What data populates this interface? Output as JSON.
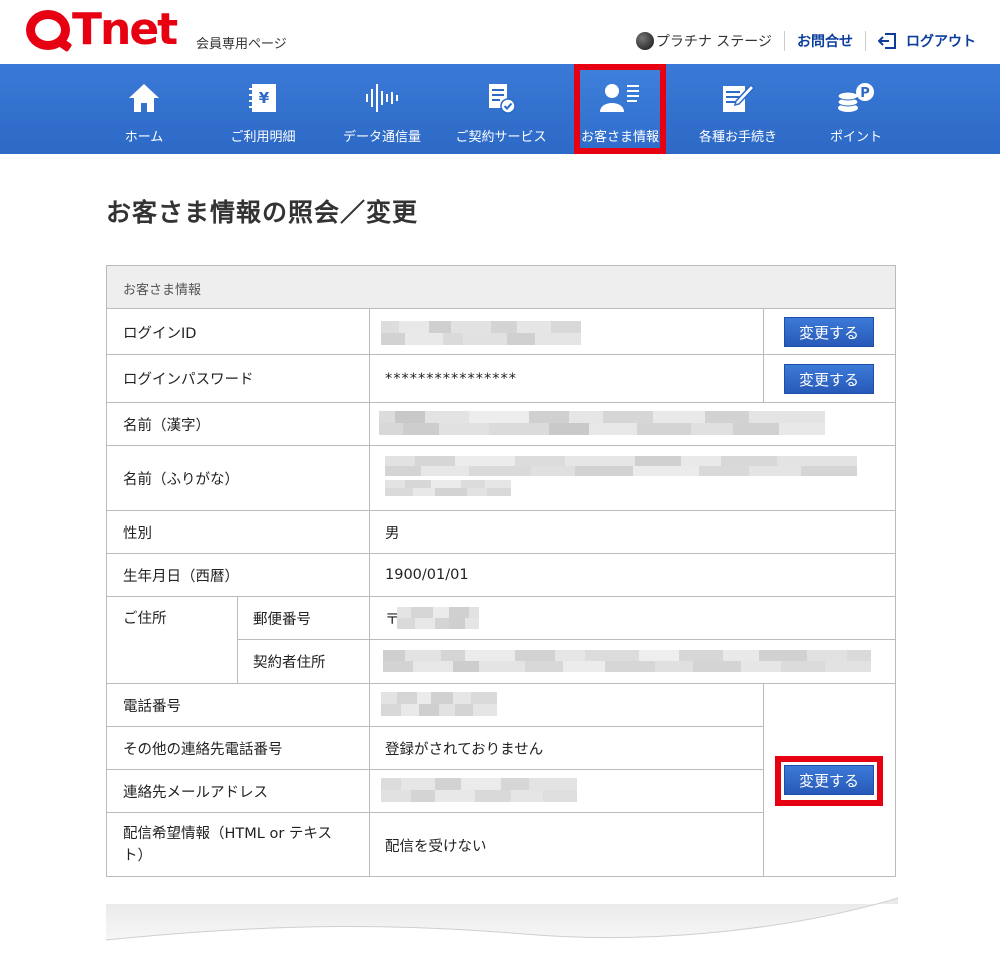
{
  "header": {
    "logo_text": "Tnet",
    "logo_sub": "会員専用ページ",
    "stage_label": "プラチナ ステージ",
    "inquiry_label": "お問合せ",
    "logout_label": "ログアウト"
  },
  "nav": {
    "items": [
      {
        "label": "ホーム",
        "icon": "home-icon"
      },
      {
        "label": "ご利用明細",
        "icon": "statement-icon"
      },
      {
        "label": "データ通信量",
        "icon": "data-usage-icon"
      },
      {
        "label": "ご契約サービス",
        "icon": "contract-icon"
      },
      {
        "label": "お客さま情報",
        "icon": "customer-info-icon",
        "active": true
      },
      {
        "label": "各種お手続き",
        "icon": "procedure-icon"
      },
      {
        "label": "ポイント",
        "icon": "point-icon"
      }
    ]
  },
  "page": {
    "title": "お客さま情報の照会／変更"
  },
  "info": {
    "section_title": "お客さま情報",
    "rows": {
      "login_id_label": "ログインID",
      "login_password_label": "ログインパスワード",
      "login_password_value": "****************",
      "name_kanji_label": "名前（漢字）",
      "name_kana_label": "名前（ふりがな）",
      "gender_label": "性別",
      "gender_value": "男",
      "birthday_label": "生年月日（西暦）",
      "birthday_value": "1900/01/01",
      "address_label": "ご住所",
      "postal_label": "郵便番号",
      "postal_prefix": "〒",
      "contract_address_label": "契約者住所",
      "phone_label": "電話番号",
      "other_phone_label": "その他の連絡先電話番号",
      "other_phone_value": "登録がされておりません",
      "email_label": "連絡先メールアドレス",
      "delivery_label": "配信希望情報（HTML or テキスト）",
      "delivery_value": "配信を受けない"
    },
    "change_label": "変更する"
  },
  "colors": {
    "brand_red": "#e60012",
    "nav_blue": "#3a7ad6",
    "link_blue": "#0a3d9c"
  }
}
